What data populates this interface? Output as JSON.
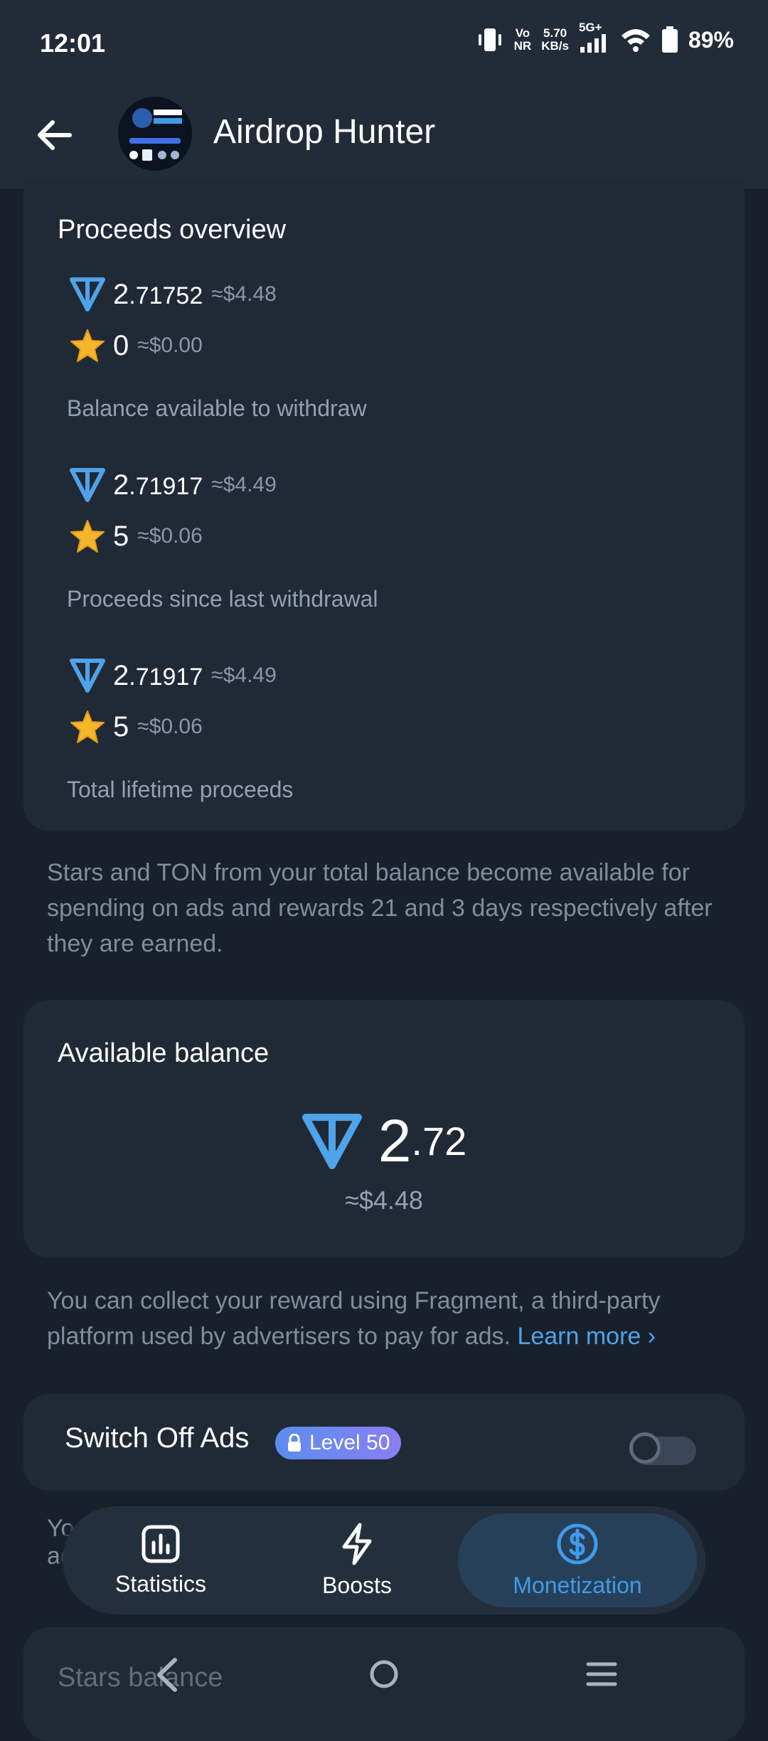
{
  "status_bar": {
    "time": "12:01",
    "volte_top": "Vo",
    "volte_bottom": "NR",
    "speed_top": "5.70",
    "speed_bottom": "KB/s",
    "network": "5G+",
    "battery": "89%"
  },
  "header": {
    "title": "Airdrop Hunter",
    "avatar_text": "AIRDROP HUNTER"
  },
  "proceeds": {
    "title": "Proceeds overview",
    "groups": [
      {
        "ton_int": "2",
        "ton_dec": ".71752",
        "ton_fiat": "≈$4.48",
        "stars": "0",
        "stars_fiat": "≈$0.00",
        "label": "Balance available to withdraw"
      },
      {
        "ton_int": "2",
        "ton_dec": ".71917",
        "ton_fiat": "≈$4.49",
        "stars": "5",
        "stars_fiat": "≈$0.06",
        "label": "Proceeds since last withdrawal"
      },
      {
        "ton_int": "2",
        "ton_dec": ".71917",
        "ton_fiat": "≈$4.49",
        "stars": "5",
        "stars_fiat": "≈$0.06",
        "label": "Total lifetime proceeds"
      }
    ],
    "note": "Stars and TON from your total balance become available for spending on ads and rewards 21 and 3 days respectively after they are earned."
  },
  "available": {
    "title": "Available balance",
    "int": "2",
    "dec": ".72",
    "fiat": "≈$4.48",
    "note": "You can collect your reward using Fragment, a third-party platform used by advertisers to pay for ads.",
    "learn_more": "Learn more ›"
  },
  "switch_ads": {
    "label": "Switch Off Ads",
    "badge": "Level 50",
    "enabled": false
  },
  "peek": {
    "note_start": "Yo",
    "note_start2": "ad",
    "stars_balance": "Stars balance"
  },
  "tabs": [
    {
      "label": "Statistics",
      "icon": "bar-chart-icon"
    },
    {
      "label": "Boosts",
      "icon": "lightning-icon"
    },
    {
      "label": "Monetization",
      "icon": "dollar-circle-icon"
    }
  ],
  "colors": {
    "background": "#18212b",
    "card": "#202a36",
    "accent": "#3f9be8",
    "ton": "#4fa3ea",
    "star": "#f5b72a"
  }
}
